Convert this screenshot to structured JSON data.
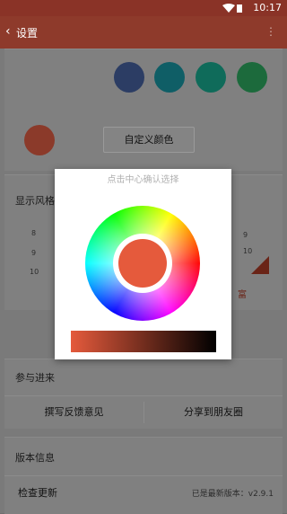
{
  "status_bar": {
    "time": "10:17"
  },
  "toolbar": {
    "back_icon": "chevron-left-icon",
    "title": "设置",
    "more_icon": "more-icon"
  },
  "theme_colors": {
    "swatches": [
      "#2c3d64",
      "#0f5e66",
      "#0f6b5a",
      "#1c6a3c"
    ],
    "selected_color": "#e55a3c"
  },
  "custom_color_button": "自定义颜色",
  "display_style": {
    "title": "显示风格",
    "left_numbers": [
      "8",
      "9",
      "10"
    ],
    "right_numbers": [
      "9",
      "10"
    ],
    "right_label": "富"
  },
  "dialog": {
    "hint": "点击中心确认选择",
    "center_color": "#e55a3c",
    "slider_start": "#e55a3c",
    "slider_end": "#000000"
  },
  "participate": {
    "title": "参与进来",
    "feedback_button": "撰写反馈意见",
    "share_button": "分享到朋友圈"
  },
  "version": {
    "title": "版本信息",
    "check_update": "检查更新",
    "latest_version_text": "已是最新版本：v2.9.1"
  }
}
